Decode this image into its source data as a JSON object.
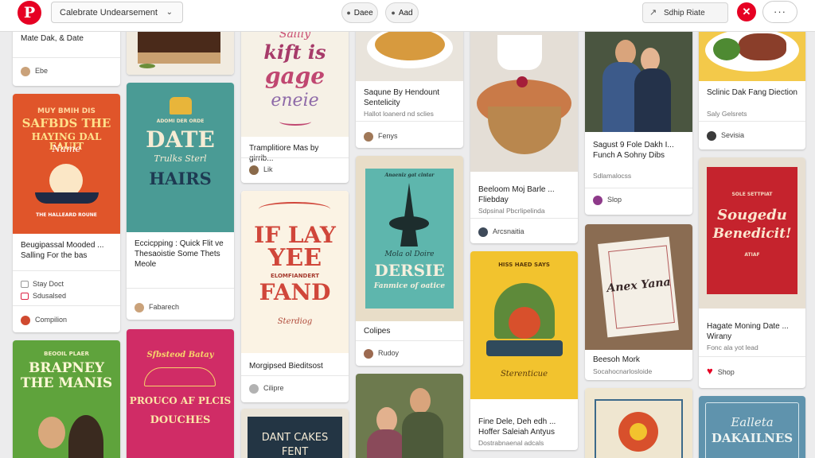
{
  "header": {
    "logo_letter": "P",
    "board_select": "Calebrate Undearsement",
    "pill_1": "Daee",
    "pill_2": "Aad",
    "search": "Sdhip Riate",
    "close_symbol": "✕",
    "more_symbol": "···"
  },
  "colors": {
    "brand": "#e60023",
    "background": "#ececed"
  },
  "pins": {
    "c1_top": {
      "title": "Mate Dak, & Date",
      "meta": "Ebe"
    },
    "c1_b": {
      "poster_l1": "MUY BMIH DIS",
      "poster_l2": "SAFBDS THE",
      "poster_l3": "HAYING DAL EAUIT",
      "poster_l4": "Name",
      "poster_small": "THE HALLEARD ROUNE",
      "title": "Beugipassal Mooded ... Salling For the bas",
      "meta_1": "Stay Doct",
      "meta_2": "Sdusalsed",
      "meta_3": "Compilion"
    },
    "c1_c": {
      "poster_l1": "BEOOIL PLAER",
      "poster_l2": "BRAPNEY",
      "poster_l3": "THE MANIS"
    },
    "c2_top": {
      "label": "cake-photo"
    },
    "c2_b": {
      "poster_l1": "ADOMI DER ORDE",
      "poster_l2": "DATE",
      "poster_l3": "Trulks Sterl",
      "poster_l4": "HAIRS",
      "title": "Eccicpping : Quick Flit ve Thesaoistie Some Thets Meole",
      "meta": "Fabarech"
    },
    "c2_c": {
      "poster_l1": "Sfbsteod Batay",
      "poster_l2": "PROUCO AF PLCIS",
      "poster_l3": "DOUCHES"
    },
    "c3_a": {
      "poster_l1": "Sallly",
      "poster_l2": "kift is",
      "poster_l3": "gage",
      "poster_l4": "eneie",
      "title": "Tramplitiore Mas by girrib...",
      "meta": "Lik"
    },
    "c3_b": {
      "poster_l1": "IF LAY",
      "poster_l2": "YEE",
      "poster_l3": "ELOMFIANDERT",
      "poster_l4": "FAND",
      "poster_small": "Sterdiog",
      "title": "Morgipsed Bieditsost",
      "meta": "Cilipre"
    },
    "c3_c": {
      "poster_l1": "DANT CAKES",
      "poster_l2": "FENT"
    },
    "c4_a": {
      "title": "Saqune By Hendount Sentelicity",
      "sub": "Hallot loanerd nd sclies",
      "meta": "Fenys"
    },
    "c4_b": {
      "poster_l1": "Anaeniz gat cintar",
      "poster_l2": "Mola ol Doire",
      "poster_l3": "DERSIE",
      "poster_l4": "Fanmice of oatice",
      "title": "Colipes",
      "meta": "Rudoy"
    },
    "c5_a": {
      "title": "Beeloom Moj Barle ... Fliebday",
      "sub": "Sdpsinal Pbcrlipelinda",
      "meta": "Arcsnaitia"
    },
    "c5_b": {
      "poster_l1": "HISS HAED SAYS",
      "poster_l2": "Sterenticue",
      "title": "Fine Dele, Deh edh ... Hoffer Saleiah Antyus",
      "sub": "Dostrabnaenal adcals"
    },
    "c6_a": {
      "title": "Sagust 9 Fole Dakh I... Funch A Sohny Dibs",
      "sub": "Sdlamalocss",
      "meta": "Slop"
    },
    "c6_b": {
      "poster_l1": "Anex Yana",
      "title": "Beesoh Mork",
      "sub": "Socahocnarlosloide"
    },
    "c7_a": {
      "title": "Sclinic Dak Fang Diection",
      "sub": "Saly Gelsrets",
      "meta": "Sevisia"
    },
    "c7_b": {
      "poster_l1": "SOLE SETTPIAT",
      "poster_l2": "Sougedu",
      "poster_l3": "Benedicit!",
      "poster_l4": "ATIAF",
      "title": "Hagate Moning Date ... Wirany",
      "sub": "Fonc ala yot lead",
      "meta": "Shop"
    },
    "c7_c": {
      "poster_l1": "Ealleta",
      "poster_l2": "DAKAILNES"
    }
  }
}
